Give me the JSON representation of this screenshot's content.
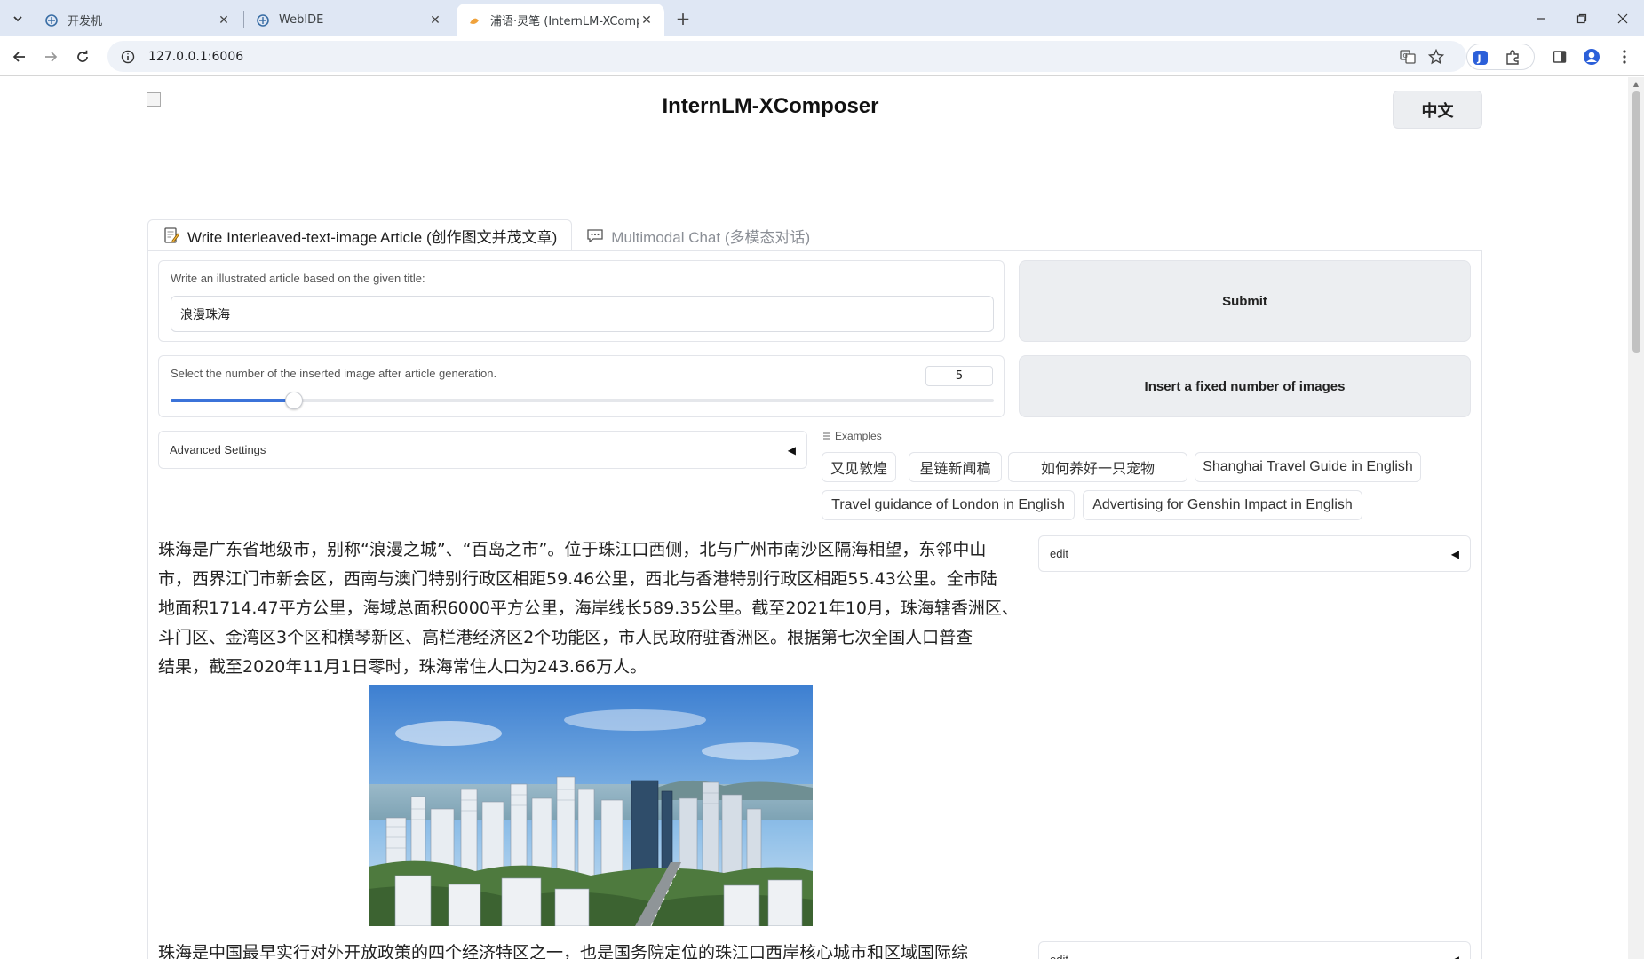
{
  "browser": {
    "tabs": [
      {
        "title": "开发机",
        "active": false
      },
      {
        "title": "WebIDE",
        "active": false
      },
      {
        "title": "浦语·灵笔 (InternLM-XCompo",
        "active": true
      }
    ],
    "url": "127.0.0.1:6006"
  },
  "app": {
    "title": "InternLM-XComposer",
    "lang_button": "中文"
  },
  "tabs": {
    "write": "Write Interleaved-text-image Article (创作图文并茂文章)",
    "chat": "Multimodal Chat (多模态对话)"
  },
  "form": {
    "title_label": "Write an illustrated article based on the given title:",
    "title_value": "浪漫珠海",
    "submit_label": "Submit",
    "images_label": "Select the number of the inserted image after article generation.",
    "images_value": "5",
    "images_slider_fraction": 0.15,
    "insert_label": "Insert a fixed number of images",
    "advanced_label": "Advanced Settings"
  },
  "examples": {
    "label": "Examples",
    "items": [
      "又见敦煌",
      "星链新闻稿",
      "如何养好一只宠物",
      "Shanghai Travel Guide in English",
      "Travel guidance of London in English",
      "Advertising for Genshin Impact in English"
    ]
  },
  "article": {
    "para1": [
      "珠海是广东省地级市，别称“浪漫之城”、“百岛之市”。位于珠江口西侧，北与广州市南沙区隔海相望，东邻中山",
      "市，西界江门市新会区，西南与澳门特别行政区相距59.46公里，西北与香港特别行政区相距55.43公里。全市陆",
      "地面积1714.47平方公里，海域总面积6000平方公里，海岸线长589.35公里。截至2021年10月，珠海辖香洲区、",
      "斗门区、金湾区3个区和横琴新区、高栏港经济区2个功能区，市人民政府驻香洲区。根据第七次全国人口普查",
      "结果，截至2020年11月1日零时，珠海常住人口为243.66万人。"
    ],
    "para2": "珠海是中国最早实行对外开放政策的四个经济特区之一，也是国务院定位的珠江口西岸核心城市和区域国际综",
    "edit_label": "edit",
    "edit_label_2": "edit"
  },
  "colors": {
    "accent": "#3b73d9",
    "tabstrip": "#dfe7f4"
  }
}
